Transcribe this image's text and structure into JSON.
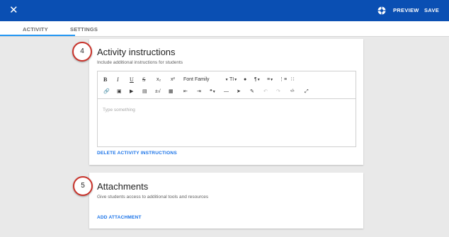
{
  "topbar": {
    "close_icon": "close-icon",
    "help_icon": "lifebuoy-help-icon",
    "preview_label": "PREVIEW",
    "save_label": "SAVE",
    "color": "#0a4fb3"
  },
  "tabs": [
    {
      "label": "ACTIVITY",
      "active": true
    },
    {
      "label": "SETTINGS",
      "active": false
    }
  ],
  "accent_color": "#2196f3",
  "sections": {
    "instructions": {
      "step": "4",
      "title": "Activity instructions",
      "subtitle": "Include additional instructions for students",
      "editor_placeholder": "Type something",
      "toolbar": {
        "bold": "B",
        "italic": "I",
        "underline": "U",
        "strikethrough": "S",
        "subscript": "x₂",
        "superscript": "x²",
        "font_family": "Font Family",
        "font_size": "TI",
        "paragraph": "¶"
      },
      "delete_label": "DELETE ACTIVITY INSTRUCTIONS"
    },
    "attachments": {
      "step": "5",
      "title": "Attachments",
      "subtitle": "Give students access to additional tools and resources",
      "add_label": "ADD ATTACHMENT"
    }
  }
}
